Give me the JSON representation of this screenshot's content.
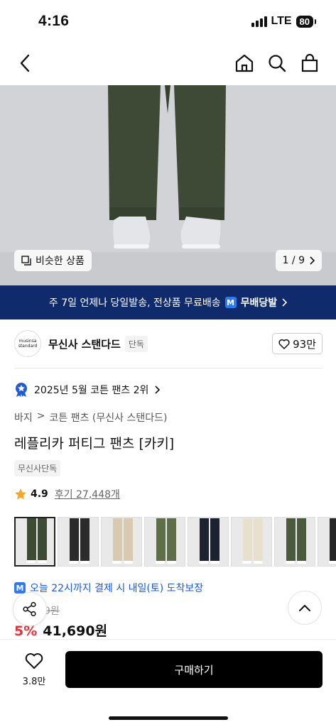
{
  "status": {
    "time": "4:16",
    "network": "LTE",
    "battery": "80"
  },
  "header": {
    "back_icon": "chevron-left-icon",
    "icons": [
      "home-icon",
      "search-icon",
      "shopping-bag-icon"
    ]
  },
  "hero": {
    "similar_label": "비슷한 상품",
    "pager": "1 / 9"
  },
  "shipping_banner": {
    "text": "주 7일 언제나 당일발송, 전상품 무료배송",
    "badge": "M",
    "strong": "무배당발"
  },
  "brand": {
    "logo_line1": "musinsa",
    "logo_line2": "standard",
    "name": "무신사 스탠다드",
    "tag": "단독",
    "likes": "93만"
  },
  "ranking": {
    "text": "2025년 5월 코튼 팬츠 2위"
  },
  "breadcrumb": [
    "바지",
    ">",
    "코튼 팬츠 (무신사 스탠다드)"
  ],
  "product": {
    "title": "레플리카 퍼티그 팬츠 [카키]",
    "exclusive_tag": "무신사단독"
  },
  "rating": {
    "value": "4.9",
    "reviews": "후기 27,448개"
  },
  "thumbnails": [
    {
      "color": "#3d4a34",
      "selected": true
    },
    {
      "color": "#2b2b2b"
    },
    {
      "color": "#d8cab0"
    },
    {
      "color": "#5e6e48"
    },
    {
      "color": "#1d2230"
    },
    {
      "color": "#e6e0cc"
    },
    {
      "color": "#4a5a3c"
    },
    {
      "color": "#262626"
    }
  ],
  "delivery": {
    "badge": "M",
    "text": "오늘 22시까지 결제 시 내일(토) 도착보장"
  },
  "price": {
    "original_partial": "9원",
    "discount": "5%",
    "final": "41,690원"
  },
  "bottom": {
    "likes": "3.8만",
    "buy_label": "구매하기"
  },
  "colors": {
    "banner": "#0f2b6b",
    "discount": "#e8323c",
    "delivery": "#1a58d6",
    "badge": "#2d7bf4"
  }
}
